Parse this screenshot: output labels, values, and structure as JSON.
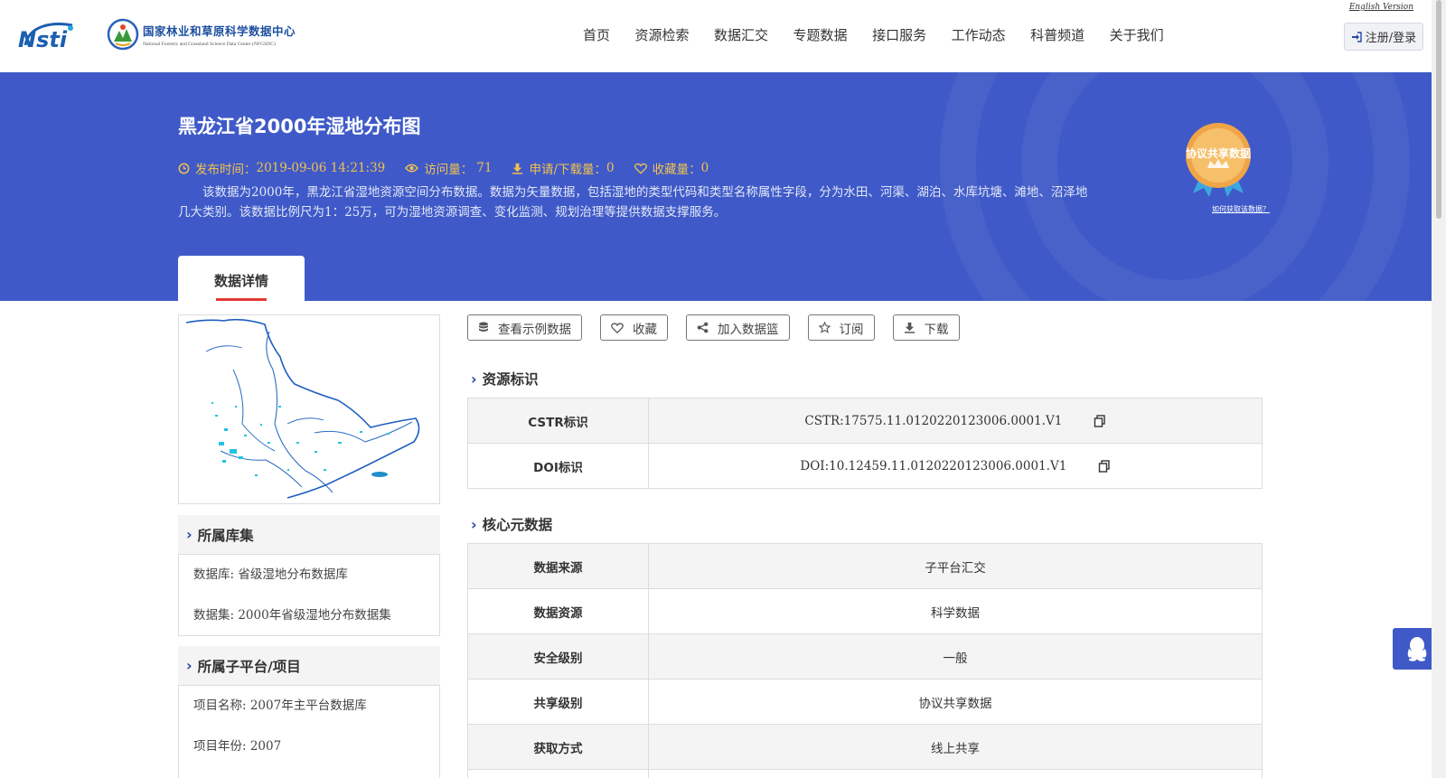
{
  "header": {
    "logo_text": "Nsti",
    "center_name_cn": "国家林业和草原科学数据中心",
    "center_name_en": "National Forestry and Grassland Science Data Center (NFGSDC)",
    "english_version": "English Version",
    "nav": [
      "首页",
      "资源检索",
      "数据汇交",
      "专题数据",
      "接口服务",
      "工作动态",
      "科普频道",
      "关于我们"
    ],
    "login_label": "注册/登录"
  },
  "dataset": {
    "title": "黑龙江省2000年湿地分布图",
    "publish_label": "发布时间：",
    "publish_time": "2019-09-06 14:21:39",
    "visits_label": "访问量：",
    "visits": "71",
    "downloads_label": "申请/下载量：",
    "downloads": "0",
    "favorites_label": "收藏量：",
    "favorites": "0",
    "description": "该数据为2000年，黑龙江省湿地资源空间分布数据。数据为矢量数据，包括湿地的类型代码和类型名称属性字段，分为水田、河渠、湖泊、水库坑塘、滩地、沼泽地几大类别。该数据比例尺为1：25万，可为湿地资源调查、变化监测、规划治理等提供数据支撑服务。",
    "badge_text": "协议共享数据",
    "badge_link": "如何获取该数据？"
  },
  "tabs": {
    "detail": "数据详情"
  },
  "sidebar": {
    "library_title": "所属库集",
    "database": "数据库: 省级湿地分布数据库",
    "dataset": "数据集: 2000年省级湿地分布数据集",
    "platform_title": "所属子平台/项目",
    "project_name": "项目名称: 2007年主平台数据库",
    "project_year": "项目年份: 2007"
  },
  "actions": {
    "view_sample": "查看示例数据",
    "favorite": "收藏",
    "add_basket": "加入数据篮",
    "subscribe": "订阅",
    "download": "下载"
  },
  "resource_id": {
    "title": "资源标识",
    "rows": [
      {
        "key": "CSTR标识",
        "value": "CSTR:17575.11.0120220123006.0001.V1"
      },
      {
        "key": "DOI标识",
        "value": "DOI:10.12459.11.0120220123006.0001.V1"
      }
    ]
  },
  "core_meta": {
    "title": "核心元数据",
    "rows": [
      {
        "key": "数据来源",
        "value": "子平台汇交"
      },
      {
        "key": "数据资源",
        "value": "科学数据"
      },
      {
        "key": "安全级别",
        "value": "一般"
      },
      {
        "key": "共享级别",
        "value": "协议共享数据"
      },
      {
        "key": "获取方式",
        "value": "线上共享"
      }
    ]
  },
  "colors": {
    "banner": "#3f5ac8",
    "meta": "#f2c14e",
    "accent": "#e53935",
    "chevron": "#2346a8"
  }
}
